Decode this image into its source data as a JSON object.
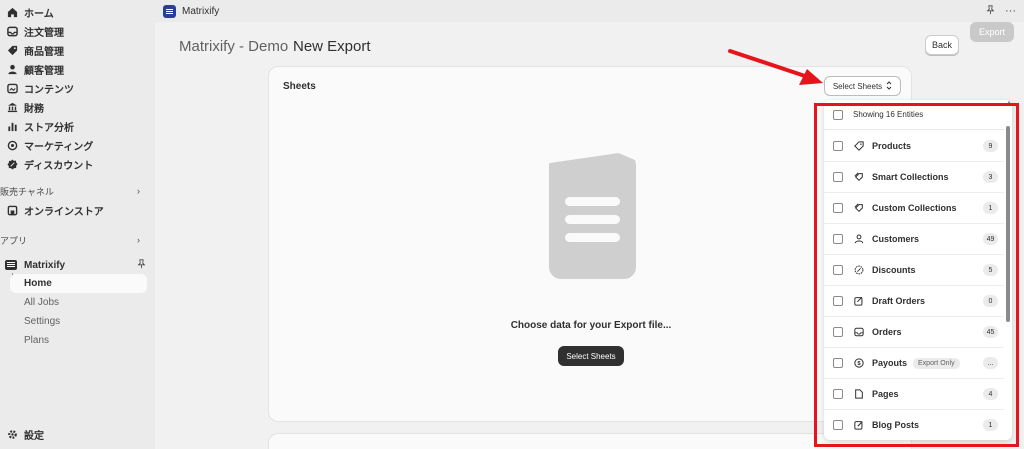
{
  "sidebar": {
    "nav": [
      {
        "label": "ホーム",
        "icon": "home-icon"
      },
      {
        "label": "注文管理",
        "icon": "inbox-icon"
      },
      {
        "label": "商品管理",
        "icon": "tag-icon"
      },
      {
        "label": "顧客管理",
        "icon": "person-icon"
      },
      {
        "label": "コンテンツ",
        "icon": "image-icon"
      },
      {
        "label": "財務",
        "icon": "bank-icon"
      },
      {
        "label": "ストア分析",
        "icon": "chart-icon"
      },
      {
        "label": "マーケティング",
        "icon": "target-icon"
      },
      {
        "label": "ディスカウント",
        "icon": "discount-icon"
      }
    ],
    "sales_channels": "販売チャネル",
    "online_store": "オンラインストア",
    "apps": "アプリ",
    "app_name": "Matrixify",
    "sub_items": [
      "Home",
      "All Jobs",
      "Settings",
      "Plans"
    ],
    "settings": "設定"
  },
  "topbar": {
    "title": "Matrixify"
  },
  "header": {
    "crumb": "Matrixify - Demo",
    "title": "New Export",
    "back": "Back",
    "export": "Export"
  },
  "card": {
    "title": "Sheets",
    "select_sheets": "Select Sheets",
    "empty_text": "Choose data for your Export file...",
    "select_sheets_button": "Select Sheets"
  },
  "dropdown": {
    "header": "Showing 16 Entities",
    "items": [
      {
        "label": "Products",
        "count": "9",
        "icon": "tag-icon"
      },
      {
        "label": "Smart Collections",
        "count": "3",
        "icon": "collection-icon"
      },
      {
        "label": "Custom Collections",
        "count": "1",
        "icon": "collection-icon"
      },
      {
        "label": "Customers",
        "count": "49",
        "icon": "person-icon"
      },
      {
        "label": "Discounts",
        "count": "5",
        "icon": "discount-icon"
      },
      {
        "label": "Draft Orders",
        "count": "0",
        "icon": "draft-icon"
      },
      {
        "label": "Orders",
        "count": "45",
        "icon": "inbox-icon"
      },
      {
        "label": "Payouts",
        "count": "...",
        "tag": "Export Only",
        "icon": "dollar-icon"
      },
      {
        "label": "Pages",
        "count": "4",
        "icon": "page-icon"
      },
      {
        "label": "Blog Posts",
        "count": "1",
        "icon": "edit-icon"
      }
    ]
  },
  "colors": {
    "highlight": "#e8141b",
    "dark_button": "#303030"
  }
}
